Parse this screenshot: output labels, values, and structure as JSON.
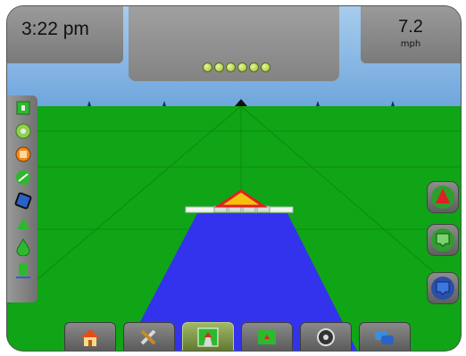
{
  "status": {
    "time": "3:22 pm",
    "speed_value": "7.2",
    "speed_unit": "mph"
  },
  "lightbar": {
    "leds_lit": 6
  },
  "colors": {
    "sky": "#8fbbe6",
    "ground": "#10a516",
    "coverage": "#3333ee",
    "vehicle": "#f4c20d",
    "button_green": "#2f9e2f",
    "button_blue": "#2a4fa8",
    "arrow_red": "#dd2222"
  },
  "left_toolbar": {
    "icons": [
      "field-boundary-icon",
      "auto-steering-icon",
      "guidance-mode-icon",
      "satellite-gps-icon",
      "boom-section-icon",
      "vehicle-marker-icon",
      "application-rate-icon",
      "implement-status-icon"
    ]
  },
  "right_toolbar": {
    "icons": [
      "vehicle-view-icon",
      "zoom-in-icon",
      "zoom-out-icon"
    ]
  },
  "bottom_toolbar": {
    "icons": [
      "home-icon",
      "tools-icon",
      "guidance-view-icon",
      "field-view-icon",
      "gauge-icon",
      "layers-icon"
    ],
    "active": "guidance-view-icon"
  }
}
